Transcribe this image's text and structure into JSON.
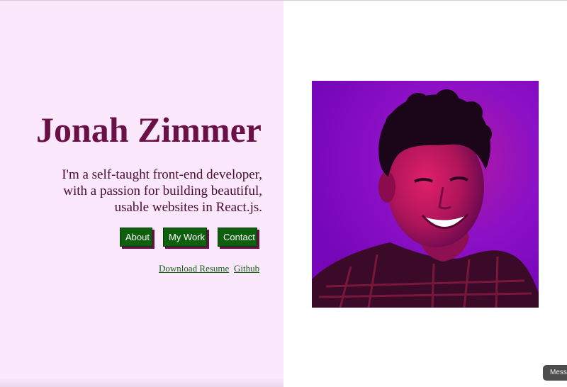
{
  "hero": {
    "name": "Jonah Zimmer",
    "tagline_lines": [
      "I'm a self-taught front-end developer,",
      "with a passion for building beautiful,",
      "usable websites in React.js."
    ]
  },
  "nav_buttons": {
    "about": "About",
    "my_work": "My Work",
    "contact": "Contact"
  },
  "links": {
    "resume": "Download Resume",
    "github": "Github"
  },
  "photo": {
    "alt": "Jonah Zimmer"
  },
  "widget": {
    "label": "Messages"
  },
  "colors": {
    "left_background": "#fbe8fd",
    "name_color": "#6b1046",
    "button_green": "#0e5f0e",
    "button_shadow": "#6b1046",
    "photo_tint": "#8a0fcf"
  }
}
